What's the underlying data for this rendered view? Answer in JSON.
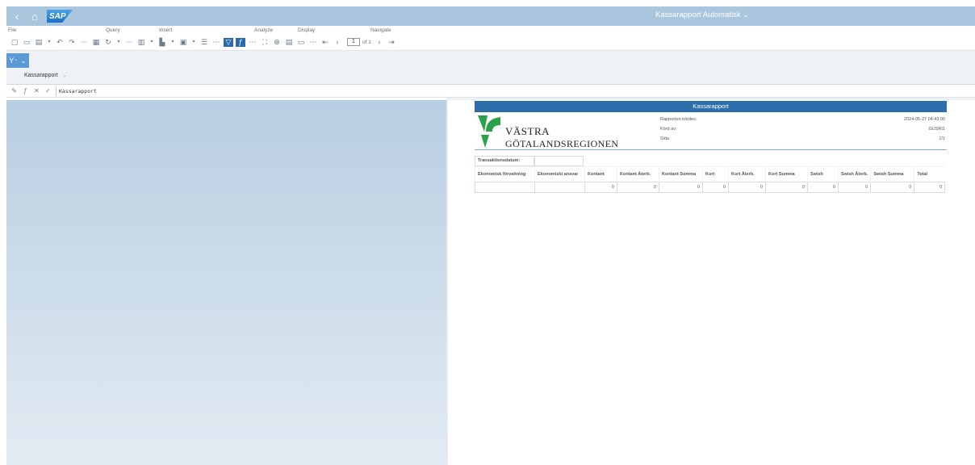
{
  "shell": {
    "back_icon": "‹",
    "home_icon": "⌂",
    "logo": "SAP",
    "title": "Kassarapport Automatisk",
    "title_chevron": "⌄"
  },
  "toolbar": {
    "groups": {
      "file": "File",
      "query": "Query",
      "insert": "Insert",
      "analyze": "Analyze",
      "display": "Display",
      "navigate": "Navigate"
    },
    "page_current": "1",
    "page_of": "of 1"
  },
  "filter_button": "Y᛫ ⌄",
  "tab": {
    "label": "Kassarapport",
    "chevron": "⌄"
  },
  "formula": {
    "value": "Kassarapport"
  },
  "report": {
    "header": "Kassarapport",
    "logo_line1": "VÄSTRA",
    "logo_line2": "GÖTALANDSREGIONEN",
    "meta": [
      {
        "label": "Rapporten kördes:",
        "value": "2024-05-27 04:43:00"
      },
      {
        "label": "Körd av:",
        "value": "GUSRI1"
      },
      {
        "label": "Sida",
        "value": "1/1"
      }
    ],
    "transaction_label": "Transaktionsdatum:",
    "columns": [
      "Ekonomisk förvaltning",
      "Ekonomiskt ansvar",
      "Kontant",
      "Kontant Återb.",
      "Kontant Summa",
      "Kort",
      "Kort Återb.",
      "Kort Summa",
      "Swish",
      "Swish Återb.",
      "Swish Summa",
      "Total"
    ],
    "rows": [
      [
        "",
        "",
        "0",
        "0",
        "0",
        "0",
        "0",
        "0",
        "0",
        "0",
        "0",
        "0"
      ]
    ]
  },
  "colors": {
    "shellbar": "#a9c6de",
    "report_header": "#2d6fab",
    "accent": "#2a6aa8",
    "logo_green": "#2aa24a",
    "logo_blue": "#1b5e9e"
  }
}
